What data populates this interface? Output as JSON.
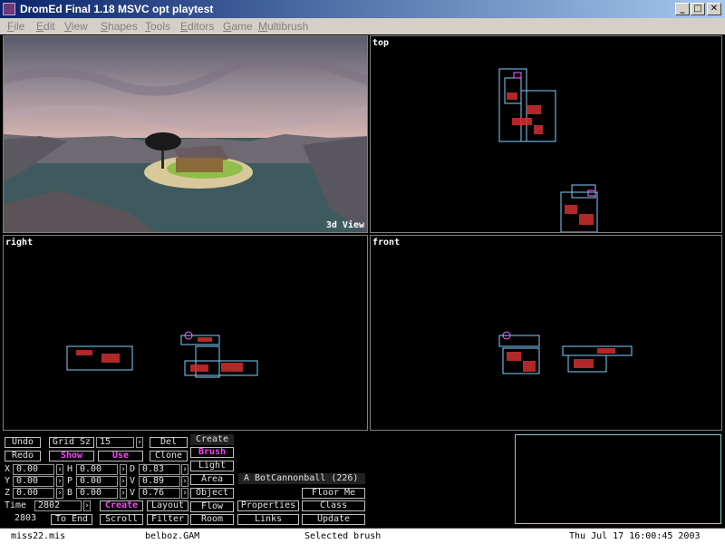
{
  "window": {
    "title": "DromEd Final 1.18 MSVC opt playtest",
    "min": "_",
    "max": "□",
    "close": "✕"
  },
  "menu": [
    "File",
    "Edit",
    "View",
    "Shapes",
    "Tools",
    "Editors",
    "Game",
    "Multibrush"
  ],
  "viewports": {
    "v3d": "3d View",
    "top": "top",
    "right": "right",
    "front": "front"
  },
  "controls": {
    "undo": "Undo",
    "redo": "Redo",
    "grid_sz": "Grid Sz",
    "grid_value": "15",
    "show": "Show",
    "use": "Use",
    "del": "Del",
    "clone": "Clone",
    "x_label": "X",
    "x_value": "0.00",
    "y_label": "Y",
    "y_value": "0.00",
    "z_label": "Z",
    "z_value": "0.00",
    "h_label": "H",
    "h_value": "0.00",
    "p_label": "P",
    "p_value": "0.00",
    "b_label": "B",
    "b_value": "0.00",
    "dx_label": "D",
    "dx_value": "0.83",
    "dy_label": "V",
    "dy_value": "0.89",
    "dz_label": "V",
    "dz_value": "0.76",
    "time_label": "Time",
    "time_value": "2802",
    "frame_value": "2803",
    "create": "Create",
    "to_end": "To End",
    "layout": "Layout",
    "scroll": "Scroll",
    "filter": "Filter",
    "create_header": "Create",
    "brush": "Brush",
    "light": "Light",
    "area": "Area",
    "object": "Object",
    "flow": "Flow",
    "room": "Room",
    "object_name": "A BotCannonball (226)",
    "floor_me": "Floor Me",
    "properties": "Properties",
    "class": "Class",
    "links": "Links",
    "update": "Update"
  },
  "status": {
    "mission": "miss22.mis",
    "gamesys": "belboz.GAM",
    "selection": "Selected brush",
    "datetime": "Thu Jul 17 16:00:45 2003"
  },
  "colors": {
    "title_start": "#0a246a",
    "title_end": "#a6caf0",
    "active_button": "#ff44ff",
    "wire_cyan": "#7fd0ff",
    "wire_red": "#d03030"
  }
}
